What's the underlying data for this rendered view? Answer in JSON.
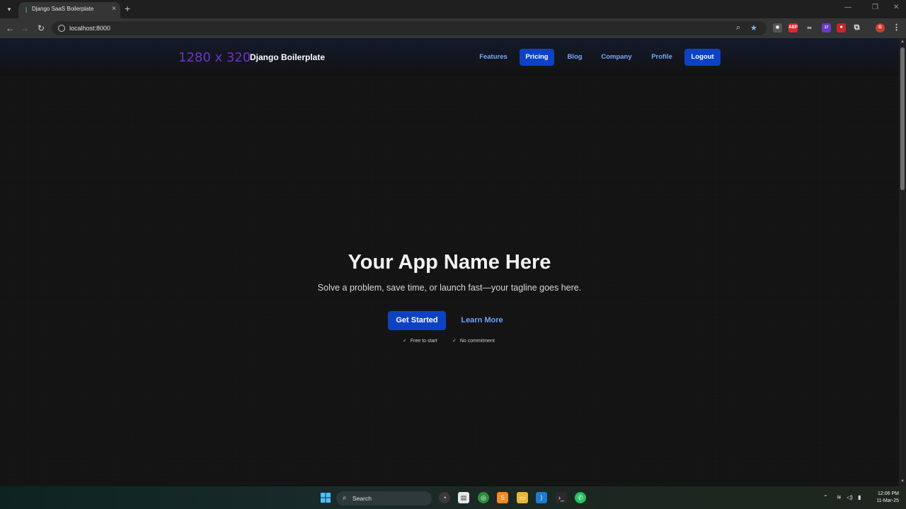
{
  "browser": {
    "tab_title": "Django SaaS Boilerplate",
    "tab_close": "×",
    "new_tab": "+",
    "url": "localhost:8000",
    "extensions": [
      {
        "name": "ABP",
        "label": "ABP",
        "color": "#e0282e"
      },
      {
        "name": "badge-17",
        "label": "17",
        "color": "#6a3ac8"
      }
    ],
    "profile_initial": "G",
    "colors": {
      "accent": "#0e42c4",
      "tab_bg": "#353535",
      "chrome_bg": "#1f1f1f"
    }
  },
  "site": {
    "logo_placeholder": "1280 x 320",
    "brand": "Django Boilerplate",
    "nav": [
      {
        "label": "Features",
        "active": false
      },
      {
        "label": "Pricing",
        "active": true
      },
      {
        "label": "Blog",
        "active": false
      },
      {
        "label": "Company",
        "active": false
      },
      {
        "label": "Profile",
        "active": false
      },
      {
        "label": "Logout",
        "active": true
      }
    ]
  },
  "hero": {
    "title": "Your App Name Here",
    "tagline": "Solve a problem, save time, or launch fast—your tagline goes here.",
    "primary_cta": "Get Started",
    "secondary_cta": "Learn More",
    "perks": [
      "Free to start",
      "No commitment"
    ]
  },
  "taskbar": {
    "search_label": "Search",
    "clock_time": "12:06 PM",
    "clock_date": "11-Mar-25"
  }
}
